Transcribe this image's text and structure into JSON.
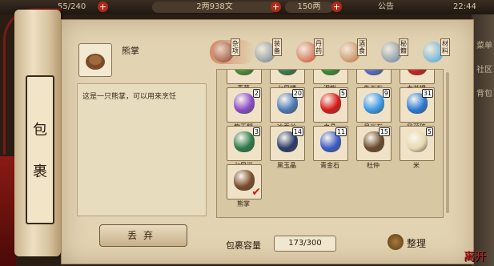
{
  "topbar": {
    "stamina": "55/240",
    "money": "2两938文",
    "gold": "150两",
    "notice": "公告",
    "time": "22:44"
  },
  "side_menu": [
    "菜单",
    "社区",
    "背包"
  ],
  "scroll": {
    "title_1": "包",
    "title_2": "裹"
  },
  "selected_item": {
    "name": "熊掌",
    "description": "这是一只熊掌，可以用来烹饪"
  },
  "drop_button": "丢弃",
  "categories": [
    {
      "label": "杂项",
      "icon": "misc-icon",
      "color": "#8a3a20"
    },
    {
      "label": "装备",
      "icon": "equipment-icon",
      "color": "#6a7a8a"
    },
    {
      "label": "丹药",
      "icon": "pill-icon",
      "color": "#c84020"
    },
    {
      "label": "酒食",
      "icon": "food-icon",
      "color": "#b86a30"
    },
    {
      "label": "秘籍",
      "icon": "book-icon",
      "color": "#5a7a9a"
    },
    {
      "label": "材料",
      "icon": "material-icon",
      "color": "#3aa0d8"
    }
  ],
  "items": [
    {
      "name": "青菜",
      "qty": "",
      "color": "#4a8a3a",
      "partial": true
    },
    {
      "name": "七星幡",
      "qty": "",
      "color": "#3a7a4a",
      "partial": true
    },
    {
      "name": "泥鳅",
      "qty": "",
      "color": "#3a8a3a",
      "partial": true
    },
    {
      "name": "先天石",
      "qty": "",
      "color": "#5a6ac8",
      "partial": true
    },
    {
      "name": "血苔提",
      "qty": "",
      "color": "#c82020",
      "partial": true
    },
    {
      "name": "紫玉髓",
      "qty": "2",
      "color": "#8a4ac8"
    },
    {
      "name": "冰蚕丝",
      "qty": "20",
      "color": "#4a7ab8"
    },
    {
      "name": "血晶",
      "qty": "5",
      "color": "#d81818"
    },
    {
      "name": "月光石",
      "qty": "9",
      "color": "#3a9ae8"
    },
    {
      "name": "风蕴珠",
      "qty": "31",
      "color": "#2a7ad8"
    },
    {
      "name": "七星岩",
      "qty": "3",
      "color": "#2a7a4a"
    },
    {
      "name": "黑玉晶",
      "qty": "14",
      "color": "#2a3a6a"
    },
    {
      "name": "青金石",
      "qty": "11",
      "color": "#3a5ac8"
    },
    {
      "name": "杜仲",
      "qty": "15",
      "color": "#6a4a2a"
    },
    {
      "name": "米",
      "qty": "5",
      "color": "#e8d8b0"
    },
    {
      "name": "熊掌",
      "qty": "",
      "color": "#7a4a2a",
      "selected": true
    }
  ],
  "capacity": {
    "label": "包裹容量",
    "value": "173/300"
  },
  "sort_button": "整理",
  "logo": "离开"
}
